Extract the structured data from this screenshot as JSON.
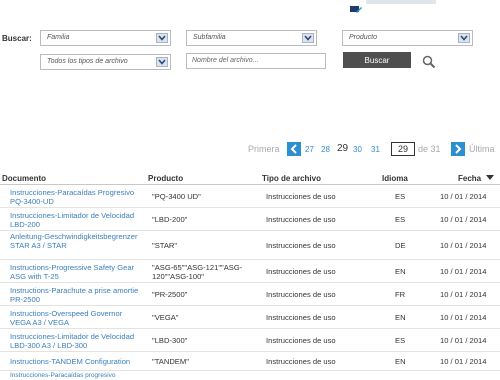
{
  "search": {
    "label": "Buscar:",
    "familia": "Familia",
    "subfamilia": "Subfamilia",
    "producto": "Producto",
    "tipo_archivo": "Todos los tipos de archivo",
    "nombre_placeholder": "Nombre del archivo...",
    "button_label": "Buscar"
  },
  "pager": {
    "first": "Primera",
    "pages": [
      "27",
      "28",
      "29",
      "30",
      "31"
    ],
    "current": "29",
    "page_input": "29",
    "of_label": "de 31",
    "last": "Última"
  },
  "table": {
    "headers": {
      "documento": "Documento",
      "producto": "Producto",
      "tipo": "Tipo de archivo",
      "idioma": "Idioma",
      "fecha": "Fecha"
    },
    "rows": [
      {
        "doc": "Instrucciones-Paracaídas Progresivo PQ-3400-UD",
        "prod": "\"PQ-3400 UD\"",
        "tipo": "Instrucciones de uso",
        "lang": "ES",
        "fecha": "10 / 01 / 2014"
      },
      {
        "doc": "Instrucciones-Limitador de Velocidad LBD-200",
        "prod": "\"LBD-200\"",
        "tipo": "Instrucciones de uso",
        "lang": "ES",
        "fecha": "10 / 01 / 2014"
      },
      {
        "doc": "Anleitung-Geschwindigkeitsbegrenzer STAR A3 / STAR",
        "prod": "\"STAR\"",
        "tipo": "Instrucciones de uso",
        "lang": "DE",
        "fecha": "10 / 01 / 2014"
      },
      {
        "doc": "Instructions-Progressive Safety Gear ASG with T-25",
        "prod": "\"ASG-65\"\"ASG-121\"\"ASG-120\"\"ASG-100\"",
        "tipo": "Instrucciones de uso",
        "lang": "EN",
        "fecha": "10 / 01 / 2014"
      },
      {
        "doc": "Instructions-Parachute a prise amortie PR-2500",
        "prod": "\"PR-2500\"",
        "tipo": "Instrucciones de uso",
        "lang": "FR",
        "fecha": "10 / 01 / 2014"
      },
      {
        "doc": "Instructions-Overspeed Governor VEGA A3 / VEGA",
        "prod": "\"VEGA\"",
        "tipo": "Instrucciones de uso",
        "lang": "EN",
        "fecha": "10 / 01 / 2014"
      },
      {
        "doc": "Instrucciones-Limitador de Velocidad LBD-300 A3 / LBD-300",
        "prod": "\"LBD-300\"",
        "tipo": "Instrucciones de uso",
        "lang": "ES",
        "fecha": "10 / 01 / 2014"
      },
      {
        "doc": "Instructions-TANDEM Configuration",
        "prod": "\"TANDEM\"",
        "tipo": "Instrucciones de uso",
        "lang": "EN",
        "fecha": "10 / 01 / 2014"
      },
      {
        "doc": "Instrucciones-Paracaídas progresivo",
        "prod": "",
        "tipo": "",
        "lang": "",
        "fecha": ""
      }
    ]
  },
  "colors": {
    "link": "#3b7fb8",
    "pager_accent": "#2e8fd0",
    "button_bg": "#4f4f4f"
  },
  "icons": {
    "top": "pdf-edit-icon",
    "search": "magnifier-icon",
    "prev": "chevron-left-icon",
    "next": "chevron-right-icon",
    "sort": "sort-desc-icon"
  }
}
